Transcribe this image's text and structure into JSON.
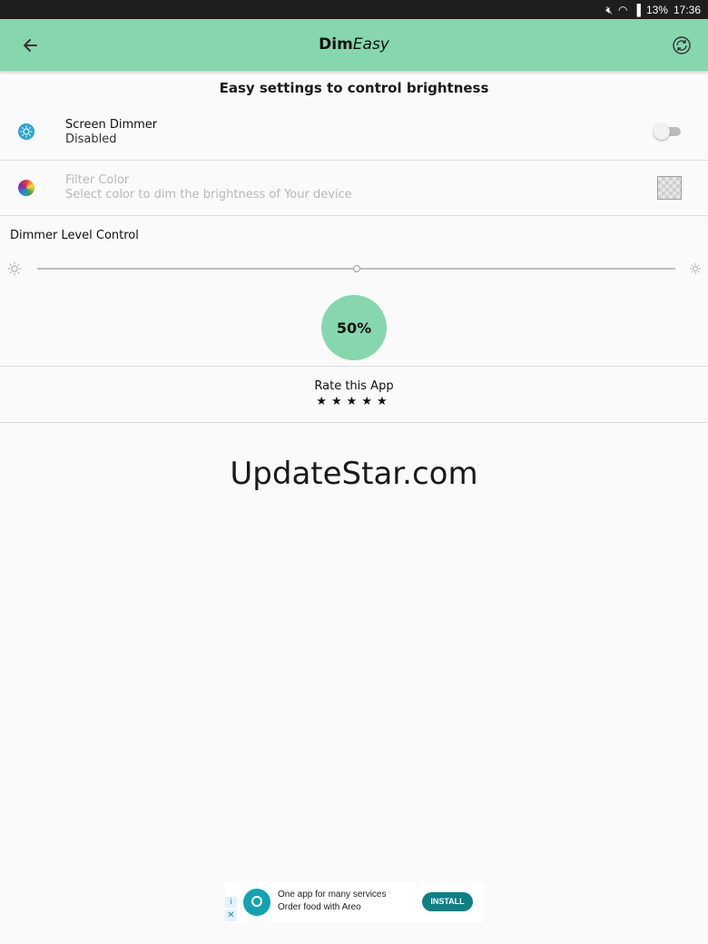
{
  "status_bar": {
    "battery": "13%",
    "time": "17:36",
    "icons": [
      "mute-icon",
      "wifi-icon",
      "signal-icon"
    ]
  },
  "app_bar": {
    "title_bold": "Dim",
    "title_italic": "Easy",
    "back_icon": "back-arrow-icon",
    "sync_icon": "sync-icon",
    "color": "#86d7ad"
  },
  "subtitle": "Easy settings to control brightness",
  "screen_dimmer": {
    "label": "Screen Dimmer",
    "status": "Disabled",
    "enabled": false
  },
  "filter_color": {
    "label": "Filter Color",
    "description": "Select color to dim the brightness of Your device"
  },
  "dimmer_level": {
    "label": "Dimmer Level Control",
    "value_fraction": 0.5,
    "percent_text": "50%"
  },
  "rate": {
    "label": "Rate this App",
    "stars": "★★★★★"
  },
  "watermark": "UpdateStar.com",
  "ad": {
    "line1": "One app for many services",
    "line2": "Order food with Areo",
    "install": "INSTALL"
  }
}
